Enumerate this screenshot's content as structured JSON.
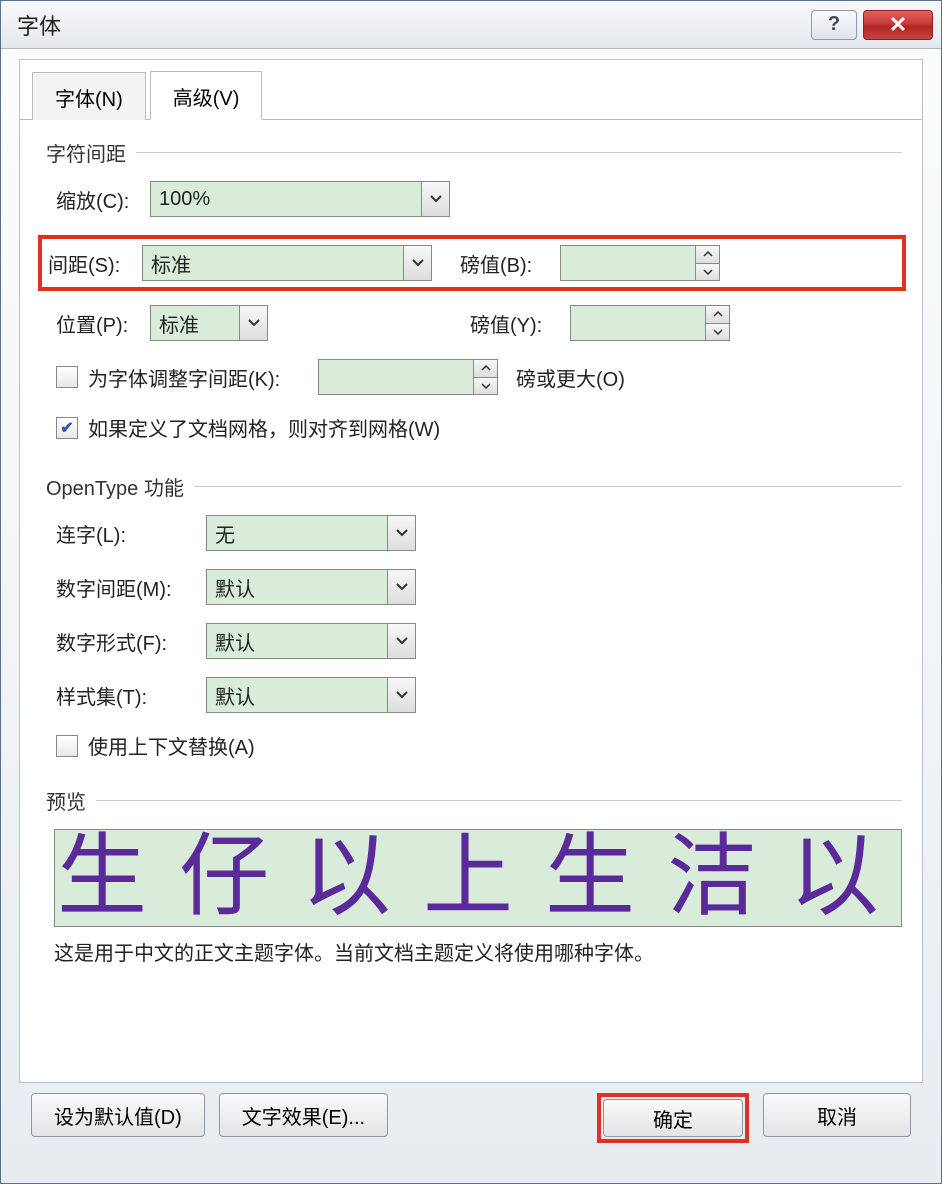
{
  "window": {
    "title": "字体"
  },
  "titlebar": {
    "help": "?",
    "close": "✕"
  },
  "tabs": {
    "font": "字体(N)",
    "advanced": "高级(V)"
  },
  "section_spacing": {
    "title": "字符间距",
    "scale_label": "缩放(C):",
    "scale_value": "100%",
    "spacing_label": "间距(S):",
    "spacing_value": "标准",
    "spacing_points_label": "磅值(B):",
    "spacing_points_value": "",
    "position_label": "位置(P):",
    "position_value": "标准",
    "position_points_label": "磅值(Y):",
    "position_points_value": "",
    "kerning_label": "为字体调整字间距(K):",
    "kerning_value": "",
    "kerning_suffix": "磅或更大(O)",
    "snap_label": "如果定义了文档网格，则对齐到网格(W)"
  },
  "section_opentype": {
    "title": "OpenType 功能",
    "ligatures_label": "连字(L):",
    "ligatures_value": "无",
    "num_spacing_label": "数字间距(M):",
    "num_spacing_value": "默认",
    "num_form_label": "数字形式(F):",
    "num_form_value": "默认",
    "style_set_label": "样式集(T):",
    "style_set_value": "默认",
    "contextual_label": "使用上下文替换(A)"
  },
  "section_preview": {
    "title": "预览",
    "sample": "生仔以上生洁以",
    "description": "这是用于中文的正文主题字体。当前文档主题定义将使用哪种字体。"
  },
  "buttons": {
    "set_default": "设为默认值(D)",
    "text_effects": "文字效果(E)...",
    "ok": "确定",
    "cancel": "取消"
  }
}
